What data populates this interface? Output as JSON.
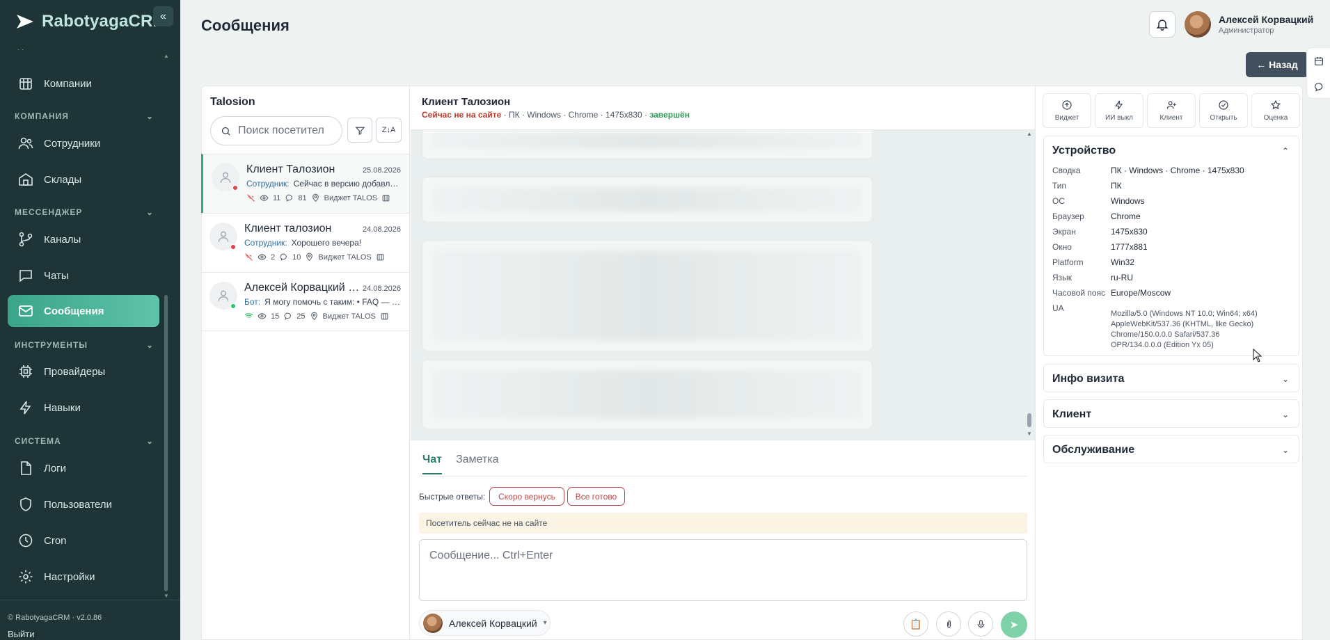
{
  "sidebar": {
    "brand": "RabotyagaCRM",
    "items": [
      {
        "label": "Компании"
      },
      {
        "section": "КОМПАНИЯ"
      },
      {
        "label": "Сотрудники"
      },
      {
        "label": "Склады"
      },
      {
        "section": "МЕССЕНДЖЕР"
      },
      {
        "label": "Каналы"
      },
      {
        "label": "Чаты"
      },
      {
        "label": "Сообщения",
        "active": true
      },
      {
        "section": "ИНСТРУМЕНТЫ"
      },
      {
        "label": "Провайдеры"
      },
      {
        "label": "Навыки"
      },
      {
        "section": "СИСТЕМА"
      },
      {
        "label": "Логи"
      },
      {
        "label": "Пользователи"
      },
      {
        "label": "Cron"
      },
      {
        "label": "Настройки"
      }
    ],
    "footer": "© RabotyagaCRM · v2.0.86",
    "logout": "Выйти"
  },
  "header": {
    "title": "Сообщения",
    "user_name": "Алексей Корвацкий",
    "user_role": "Администратор",
    "back": "← Назад"
  },
  "visitors": {
    "title": "Talosion",
    "search_placeholder": "Поиск посетител",
    "sort_label": "Z↓A",
    "list": [
      {
        "name": "Клиент Талозион",
        "date": "25.08.2026",
        "sender": "Сотрудник:",
        "message": "Сейчас в версию добавлены новые функции",
        "views": "11",
        "messages": "81",
        "widget": "Виджет TALOS",
        "status": "offline"
      },
      {
        "name": "Клиент талозион",
        "date": "24.08.2026",
        "sender": "Сотрудник:",
        "message": "Хорошего вечера!",
        "views": "2",
        "messages": "10",
        "widget": "Виджет TALOS",
        "status": "offline"
      },
      {
        "name": "Алексей Корвацкий (Telegram)",
        "date": "24.08.2026",
        "sender": "Бот:",
        "message": "Я могу помочь с таким: • FAQ — ответы на вопросы",
        "views": "15",
        "messages": "25",
        "widget": "Виджет TALOS",
        "status": "online"
      }
    ]
  },
  "chat": {
    "title": "Клиент Талозион",
    "status": "Сейчас не на сайте",
    "device": " · ПК · Windows · Chrome · 1475x830 · ",
    "state": "завершён",
    "tabs": [
      "Чат",
      "Заметка"
    ],
    "quick_label": "Быстрые ответы:",
    "quick_replies": [
      "Скоро вернусь",
      "Все готово"
    ],
    "notice": "Посетитель сейчас не на сайте",
    "composer_placeholder": "Сообщение... Ctrl+Enter",
    "agent": "Алексей Корвацкий"
  },
  "actions": [
    "Виджет",
    "ИИ выкл",
    "Клиент",
    "Открыть",
    "Оценка"
  ],
  "device_card": {
    "title": "Устройство",
    "rows": [
      {
        "k": "Сводка",
        "v": "ПК · Windows · Chrome · 1475x830"
      },
      {
        "k": "Тип",
        "v": "ПК"
      },
      {
        "k": "ОС",
        "v": "Windows"
      },
      {
        "k": "Браузер",
        "v": "Chrome"
      },
      {
        "k": "Экран",
        "v": "1475x830"
      },
      {
        "k": "Окно",
        "v": "1777x881"
      },
      {
        "k": "Platform",
        "v": "Win32"
      },
      {
        "k": "Язык",
        "v": "ru-RU"
      },
      {
        "k": "Часовой пояс",
        "v": "Europe/Moscow"
      }
    ],
    "ua_label": "UA",
    "ua": "Mozilla/5.0 (Windows NT 10.0; Win64; x64) AppleWebKit/537.36 (KHTML, like Gecko) Chrome/150.0.0.0 Safari/537.36 OPR/134.0.0.0 (Edition Yx 05)"
  },
  "cards": [
    "Инфо визита",
    "Клиент",
    "Обслуживание"
  ],
  "colors": {
    "sidebar": "#1e3437",
    "accent": "#3aa58a",
    "danger": "#b94a48",
    "offline_dot": "#e0424a",
    "online_dot": "#2ebf6a"
  }
}
